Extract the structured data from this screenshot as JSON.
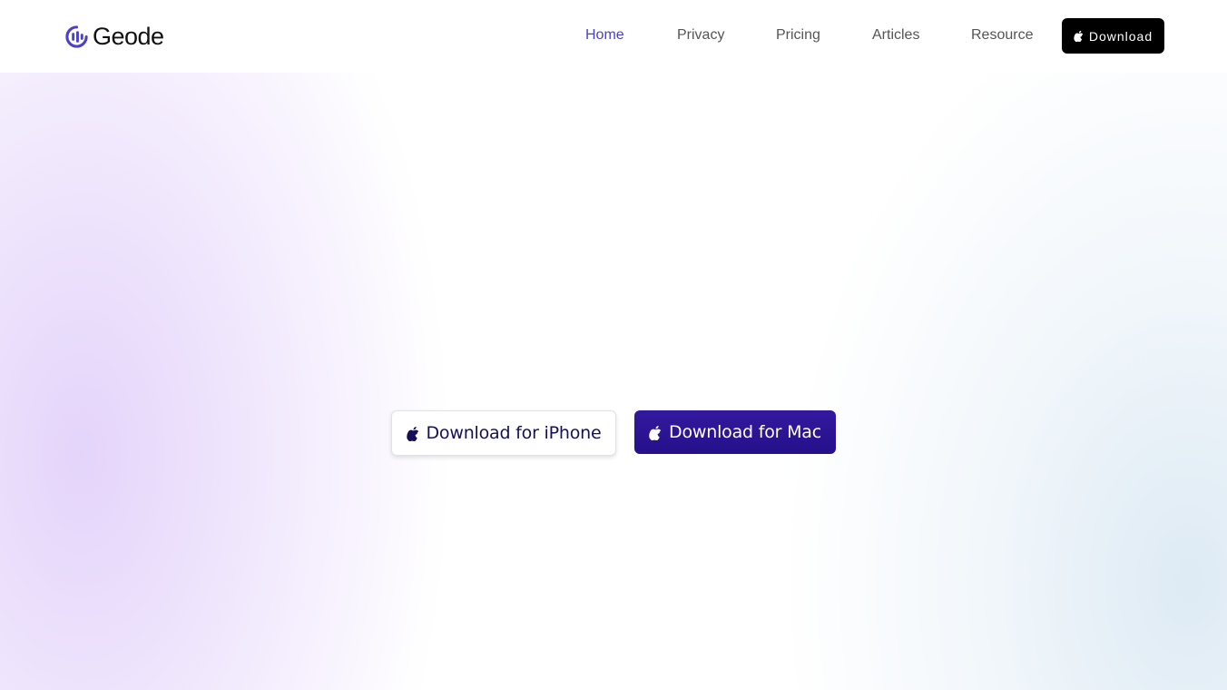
{
  "header": {
    "logo_text": "Geode",
    "nav": [
      {
        "label": "Home",
        "active": true
      },
      {
        "label": "Privacy",
        "active": false
      },
      {
        "label": "Pricing",
        "active": false
      },
      {
        "label": "Articles",
        "active": false
      },
      {
        "label": "Resource",
        "active": false
      }
    ],
    "download_label": "Download"
  },
  "hero": {
    "iphone_button_label": "Download for iPhone",
    "mac_button_label": "Download for Mac"
  },
  "icons": {
    "logo": "geode-logo-icon",
    "apple": "apple-icon"
  },
  "colors": {
    "accent": "#4a3fd0",
    "mac_button": "#2a1494",
    "iphone_text": "#14105a",
    "nav_text": "#555555"
  }
}
